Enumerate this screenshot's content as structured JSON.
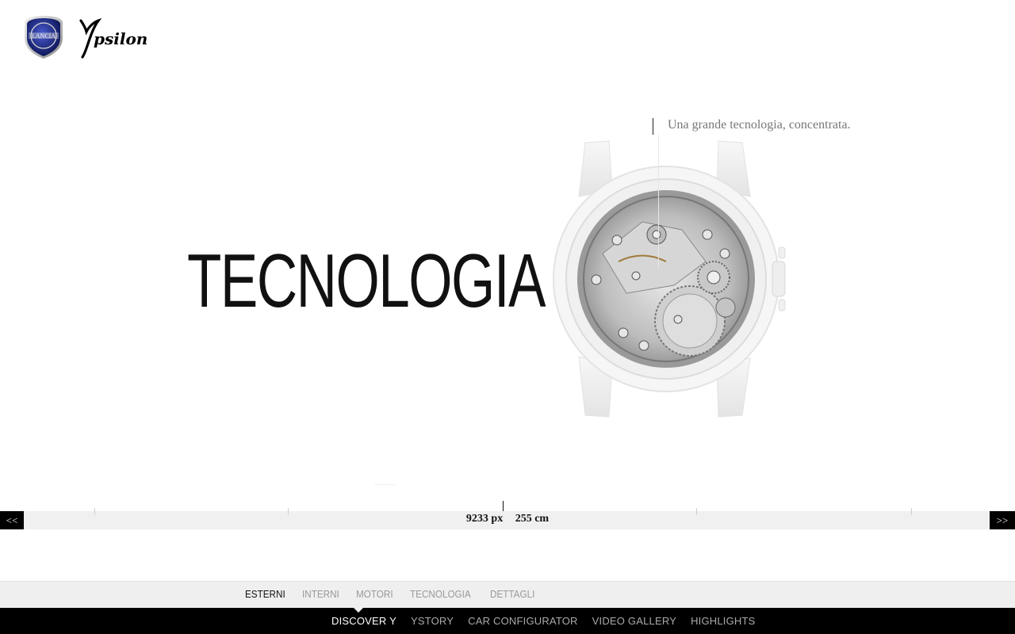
{
  "brand": {
    "logo_text": "LANCIA",
    "model_text": "Ypsilon"
  },
  "hero": {
    "title": "TECNOLOGIA",
    "tagline": "Una grande tecnologia, concentrata."
  },
  "ruler": {
    "prev_label": "<<",
    "next_label": ">>",
    "px_readout": "9233 px",
    "cm_readout": "255 cm"
  },
  "subnav": {
    "items": [
      {
        "label": "ESTERNI",
        "active": true
      },
      {
        "label": "INTERNI"
      },
      {
        "label": "MOTORI"
      },
      {
        "label": "TECNOLOGIA"
      },
      {
        "label": "DETTAGLI"
      }
    ]
  },
  "mainnav": {
    "items": [
      {
        "label": "DISCOVER Y",
        "active": true
      },
      {
        "label": "YSTORY"
      },
      {
        "label": "CAR CONFIGURATOR"
      },
      {
        "label": "VIDEO GALLERY"
      },
      {
        "label": "HIGHLIGHTS"
      }
    ]
  }
}
